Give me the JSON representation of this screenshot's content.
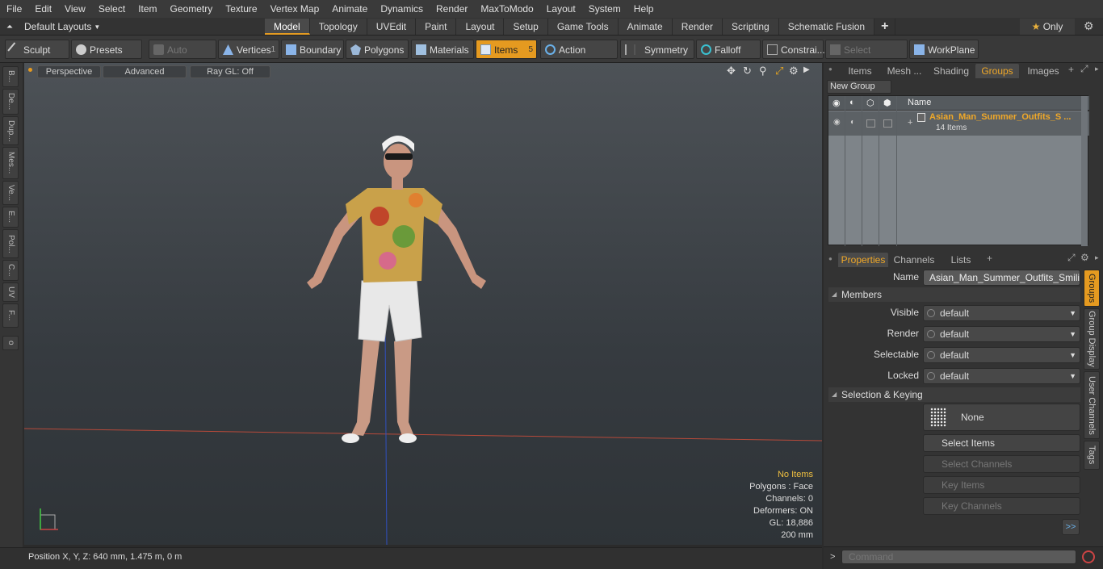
{
  "menu": [
    "File",
    "Edit",
    "View",
    "Select",
    "Item",
    "Geometry",
    "Texture",
    "Vertex Map",
    "Animate",
    "Dynamics",
    "Render",
    "MaxToModo",
    "Layout",
    "System",
    "Help"
  ],
  "layouts_label": "Default Layouts",
  "tabs": [
    "Model",
    "Topology",
    "UVEdit",
    "Paint",
    "Layout",
    "Setup",
    "Game Tools",
    "Animate",
    "Render",
    "Scripting",
    "Schematic Fusion"
  ],
  "active_tab": "Model",
  "only_label": "Only",
  "toolbar": {
    "sculpt": "Sculpt",
    "presets": "Presets",
    "auto_select": "Auto Select",
    "vertices": "Vertices",
    "vertices_count": "1",
    "boundary": "Boundary",
    "polygons": "Polygons",
    "materials": "Materials",
    "items": "Items",
    "items_count": "5",
    "action_center": "Action Center",
    "symmetry": "Symmetry",
    "falloff": "Falloff",
    "constraints": "Constrai...",
    "select_through": "Select Through",
    "workplane": "WorkPlane"
  },
  "left_tabs": [
    "B...",
    "De...",
    "Dup...",
    "Mes...",
    "Ve...",
    "E...",
    "Pol...",
    "C...",
    "UV",
    "F..."
  ],
  "viewport": {
    "perspective": "Perspective",
    "advanced": "Advanced",
    "raygl": "Ray GL: Off",
    "stats": {
      "no_items": "No Items",
      "polygons": "Polygons : Face",
      "channels": "Channels: 0",
      "deformers": "Deformers: ON",
      "gl": "GL: 18,886",
      "scale": "200 mm"
    }
  },
  "status_position": "Position X, Y, Z:   640 mm, 1.475 m, 0 m",
  "right_tabs": [
    "Items",
    "Mesh ...",
    "Shading",
    "Groups",
    "Images"
  ],
  "active_right_tab": "Groups",
  "new_group": "New Group",
  "group_header_name": "Name",
  "group": {
    "name": "Asian_Man_Summer_Outfits_S ...",
    "count": "14 Items"
  },
  "prop_tabs": [
    "Properties",
    "Channels",
    "Lists"
  ],
  "props": {
    "name_label": "Name",
    "name_value": "Asian_Man_Summer_Outfits_Smiling_F",
    "members": "Members",
    "visible_label": "Visible",
    "visible": "default",
    "render_label": "Render",
    "render": "default",
    "selectable_label": "Selectable",
    "selectable": "default",
    "locked_label": "Locked",
    "locked": "default",
    "sel_keying": "Selection & Keying",
    "none": "None",
    "select_items": "Select Items",
    "select_channels": "Select Channels",
    "key_items": "Key Items",
    "key_channels": "Key Channels",
    "more": ">>"
  },
  "side_vtabs": [
    "Groups",
    "Group Display",
    "User Channels",
    "Tags"
  ],
  "command_placeholder": "Command",
  "accent": "#e59a20"
}
